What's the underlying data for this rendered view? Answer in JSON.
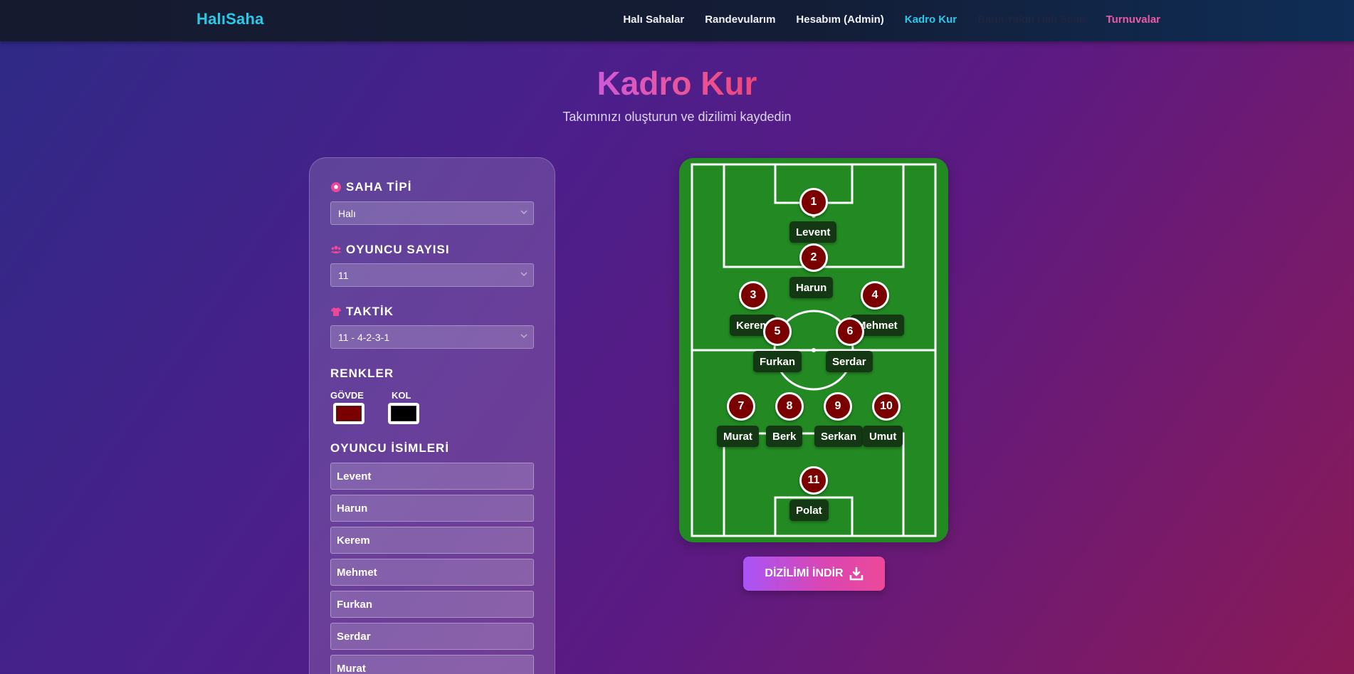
{
  "navbar": {
    "brand": "HalıSaha",
    "links": [
      {
        "label": "Halı Sahalar"
      },
      {
        "label": "Randevularım"
      },
      {
        "label": "Hesabım (Admin)"
      },
      {
        "label": "Kadro Kur"
      },
      {
        "label": "Bana Yakın Halı Saha"
      },
      {
        "label": "Turnuvalar"
      }
    ]
  },
  "hero": {
    "title": "Kadro Kur",
    "subtitle": "Takımınızı oluşturun ve dizilimi kaydedin"
  },
  "panel": {
    "field_type": {
      "label": "SAHA TİPİ",
      "value": "Halı",
      "icon": "soccer-ball-icon"
    },
    "player_count": {
      "label": "OYUNCU SAYISI",
      "value": "11",
      "icon": "users-icon"
    },
    "tactic": {
      "label": "TAKTİK",
      "value": "11 - 4-2-3-1",
      "icon": "shirt-icon"
    },
    "colors": {
      "label": "RENKLER",
      "body_label": "GÖVDE",
      "body_color": "#7a0000",
      "sleeve_label": "KOL",
      "sleeve_color": "#000000"
    },
    "names_label": "OYUNCU İSİMLERİ",
    "names": [
      "Levent",
      "Harun",
      "Kerem",
      "Mehmet",
      "Furkan",
      "Serdar",
      "Murat"
    ]
  },
  "pitch": {
    "players": [
      {
        "number": "1",
        "name": "Levent"
      },
      {
        "number": "2",
        "name": "Harun"
      },
      {
        "number": "3",
        "name": "Kerem"
      },
      {
        "number": "4",
        "name": "Mehmet"
      },
      {
        "number": "5",
        "name": "Furkan"
      },
      {
        "number": "6",
        "name": "Serdar"
      },
      {
        "number": "7",
        "name": "Murat"
      },
      {
        "number": "8",
        "name": "Berk"
      },
      {
        "number": "9",
        "name": "Serkan"
      },
      {
        "number": "10",
        "name": "Umut"
      },
      {
        "number": "11",
        "name": "Polat"
      }
    ]
  },
  "download": {
    "label": "DİZİLİMİ İNDİR",
    "icon": "download-icon"
  }
}
